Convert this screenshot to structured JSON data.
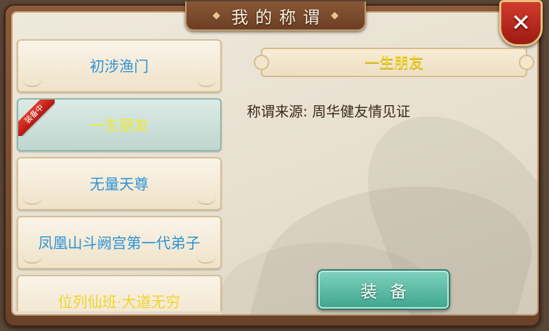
{
  "header": {
    "title": "我的称谓",
    "close_icon": "close-x-icon"
  },
  "titles": [
    {
      "label": "初涉渔门",
      "selected": false,
      "equipped": false
    },
    {
      "label": "一生朋友",
      "selected": true,
      "equipped": true
    },
    {
      "label": "无量天尊",
      "selected": false,
      "equipped": false
    },
    {
      "label": "凤凰山斗阙宫第一代弟子",
      "selected": false,
      "equipped": false
    },
    {
      "label": "位列仙班·大道无穷",
      "selected": false,
      "equipped": false
    }
  ],
  "equipped_badge": "装备中",
  "detail": {
    "name": "一生朋友",
    "source_label": "称谓来源:",
    "source_value": "周华健友情见证"
  },
  "equip_button": "装备",
  "colors": {
    "normal_title": "#2e94d6",
    "highlight_title": "#f0ea2a",
    "button_green": "#3fa58c",
    "close_red": "#c22a1f"
  }
}
